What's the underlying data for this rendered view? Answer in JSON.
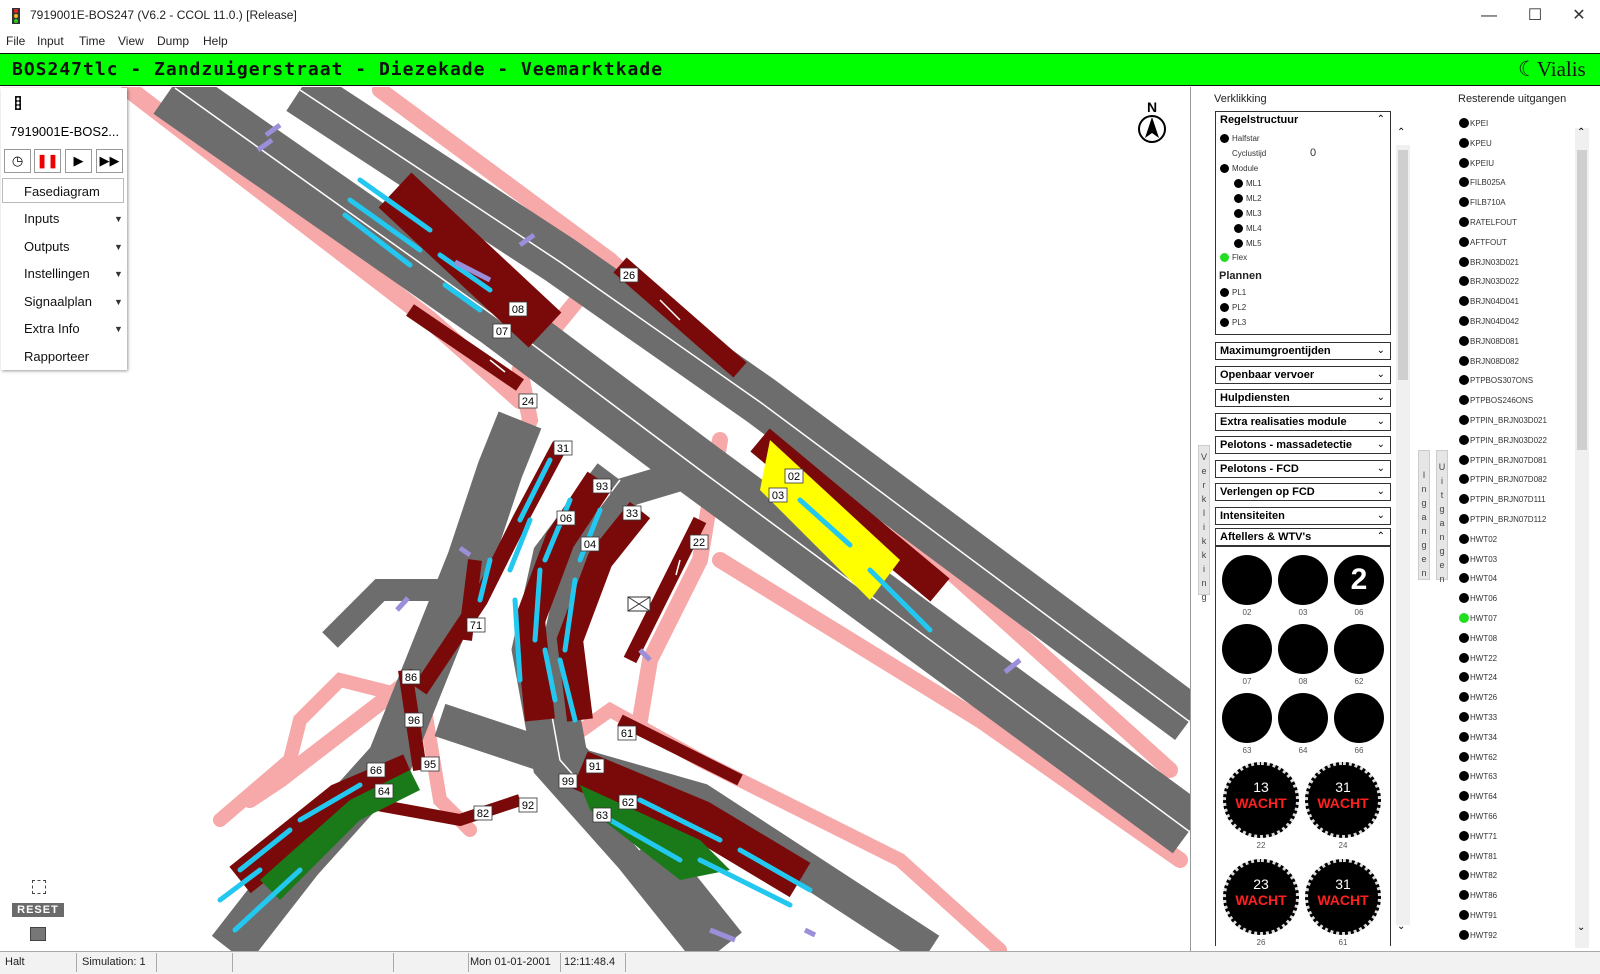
{
  "window": {
    "title": "7919001E-BOS247 (V6.2 - CCOL 11.0.) [Release]",
    "minimize": "—",
    "maximize": "☐",
    "close": "✕"
  },
  "menu": [
    "File",
    "Input",
    "Time",
    "View",
    "Dump",
    "Help"
  ],
  "header": {
    "title": "BOS247tlc - Zandzuigerstraat - Diezekade - Veemarktkade",
    "brand": "Vialis"
  },
  "leftmenu": {
    "id": "7919001E-BOS2...",
    "controls": [
      "◷",
      "❚❚",
      "▶",
      "▶▶"
    ],
    "items": [
      "Fasediagram",
      "Inputs",
      "Outputs",
      "Instellingen",
      "Signaalplan",
      "Extra Info",
      "Rapporteer"
    ],
    "arrow": "▼"
  },
  "tools": {
    "reset": "RESET"
  },
  "map": {
    "compass": "N",
    "labels": [
      "26",
      "08",
      "07",
      "24",
      "31",
      "93",
      "33",
      "06",
      "04",
      "02",
      "03",
      "22",
      "71",
      "86",
      "96",
      "95",
      "66",
      "64",
      "61",
      "91",
      "99",
      "62",
      "63",
      "82",
      "92"
    ]
  },
  "verklikking": {
    "title": "Verklikking",
    "regelstructuur": "Regelstructuur",
    "tree": {
      "halfstar": "Halfstar",
      "cyclustijd_label": "Cyclustijd",
      "cyclustijd_value": "0",
      "module": "Module",
      "modules": [
        "ML1",
        "ML2",
        "ML3",
        "ML4",
        "ML5"
      ],
      "flex": "Flex",
      "plannen": "Plannen",
      "plans": [
        "PL1",
        "PL2",
        "PL3"
      ]
    },
    "sections": [
      "Maximumgroentijden",
      "Openbaar vervoer",
      "Hulpdiensten",
      "Extra realisaties module",
      "Pelotons - massadetectie",
      "Pelotons - FCD",
      "Verlengen op FCD",
      "Intensiteiten"
    ],
    "afteller": "Aftellers & WTV's",
    "dots": [
      {
        "label": "02",
        "value": ""
      },
      {
        "label": "03",
        "value": ""
      },
      {
        "label": "06",
        "value": "2"
      },
      {
        "label": "07",
        "value": ""
      },
      {
        "label": "08",
        "value": ""
      },
      {
        "label": "62",
        "value": ""
      },
      {
        "label": "63",
        "value": ""
      },
      {
        "label": "64",
        "value": ""
      },
      {
        "label": "66",
        "value": ""
      }
    ],
    "wtv": [
      {
        "label": "22",
        "count": "13",
        "text": "WACHT"
      },
      {
        "label": "24",
        "count": "31",
        "text": "WACHT"
      },
      {
        "label": "26",
        "count": "23",
        "text": "WACHT"
      },
      {
        "label": "61",
        "count": "31",
        "text": "WACHT"
      }
    ],
    "tab_verklikking": "Verklikking",
    "tab_ingangen": "Ingangen",
    "tab_uitgangen": "Uitgangen"
  },
  "uitgangen": {
    "title": "Resterende uitgangen",
    "items": [
      "KPEI",
      "KPEU",
      "KPEIU",
      "FILB025A",
      "FILB710A",
      "RATELFOUT",
      "AFTFOUT",
      "BRJN03D021",
      "BRJN03D022",
      "BRJN04D041",
      "BRJN04D042",
      "BRJN08D081",
      "BRJN08D082",
      "PTPBOS307ONS",
      "PTPBOS246ONS",
      "PTPIN_BRJN03D021",
      "PTPIN_BRJN03D022",
      "PTPIN_BRJN07D081",
      "PTPIN_BRJN07D082",
      "PTPIN_BRJN07D111",
      "PTPIN_BRJN07D112",
      "HWT02",
      "HWT03",
      "HWT04",
      "HWT06",
      "HWT07",
      "HWT08",
      "HWT22",
      "HWT24",
      "HWT26",
      "HWT33",
      "HWT34",
      "HWT62",
      "HWT63",
      "HWT64",
      "HWT66",
      "HWT71",
      "HWT81",
      "HWT82",
      "HWT86",
      "HWT91",
      "HWT92"
    ],
    "active_index": 25
  },
  "statusbar": {
    "state": "Halt",
    "simulation": "Simulation: 1",
    "date": "Mon 01-01-2001",
    "time": "12:11:48.4"
  }
}
